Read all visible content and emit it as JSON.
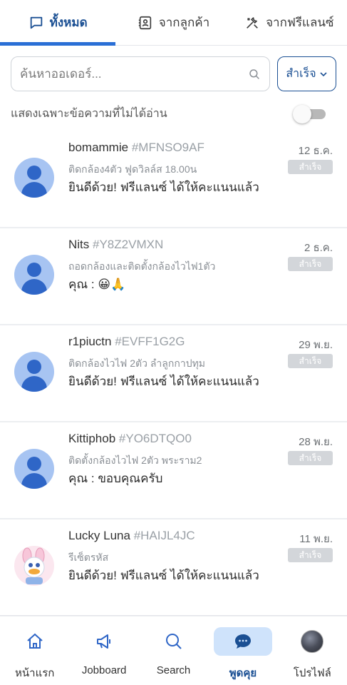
{
  "tabs": [
    {
      "label": "ทั้งหมด",
      "icon": "chat-bubble-icon",
      "active": true
    },
    {
      "label": "จากลูกค้า",
      "icon": "contact-card-icon",
      "active": false
    },
    {
      "label": "จากฟรีแลนซ์",
      "icon": "tools-icon",
      "active": false
    }
  ],
  "search": {
    "placeholder": "ค้นหาออเดอร์...",
    "value": ""
  },
  "status_filter": {
    "selected": "สำเร็จ"
  },
  "unread_filter": {
    "label": "แสดงเฉพาะข้อความที่ไม่ได้อ่าน",
    "enabled": false
  },
  "chats": [
    {
      "name": "bomammie",
      "code": "#MFNSO9AF",
      "job": "ติดกล้อง4ตัว ฟูดวิลล์ส 18.00น",
      "message": "ยินดีด้วย! ฟรีแลนซ์ ได้ให้คะแนนแล้ว",
      "date": "12 ธ.ค.",
      "status": "สำเร็จ"
    },
    {
      "name": "Nits",
      "code": "#Y8Z2VMXN",
      "job": "ถอดกล้องและติดตั้งกล้องไวไฟ1ตัว",
      "message": "คุณ : 😀🙏",
      "date": "2 ธ.ค.",
      "status": "สำเร็จ"
    },
    {
      "name": "r1piuctn",
      "code": "#EVFF1G2G",
      "job": "ติดกล้องไวไฟ 2ตัว ลำลูกกาปทุม",
      "message": "ยินดีด้วย! ฟรีแลนซ์ ได้ให้คะแนนแล้ว",
      "date": "29 พ.ย.",
      "status": "สำเร็จ"
    },
    {
      "name": "Kittiphob",
      "code": "#YO6DTQO0",
      "job": "ติดตั้งกล้องไวไฟ 2ตัว พระราม2",
      "message": "คุณ : ขอบคุณครับ",
      "date": "28 พ.ย.",
      "status": "สำเร็จ"
    },
    {
      "name": "Lucky Luna",
      "code": "#HAIJL4JC",
      "job": "รีเซ็ตรหัส",
      "message": "ยินดีด้วย! ฟรีแลนซ์ ได้ให้คะแนนแล้ว",
      "date": "11 พ.ย.",
      "status": "สำเร็จ"
    }
  ],
  "bottom_nav": [
    {
      "label": "หน้าแรก",
      "icon": "home-icon",
      "active": false
    },
    {
      "label": "Jobboard",
      "icon": "megaphone-icon",
      "active": false
    },
    {
      "label": "Search",
      "icon": "search-icon",
      "active": false
    },
    {
      "label": "พูดคุย",
      "icon": "chat-icon",
      "active": true
    },
    {
      "label": "โปรไฟล์",
      "icon": "profile-avatar-icon",
      "active": false
    }
  ],
  "colors": {
    "primary": "#1a4f93",
    "accent": "#2a6fd6",
    "badge_bg": "#d3d6da",
    "avatar_bg": "#a7c4f2",
    "avatar_fg": "#2f66c7",
    "nav_active_bg": "#cfe3fb"
  }
}
